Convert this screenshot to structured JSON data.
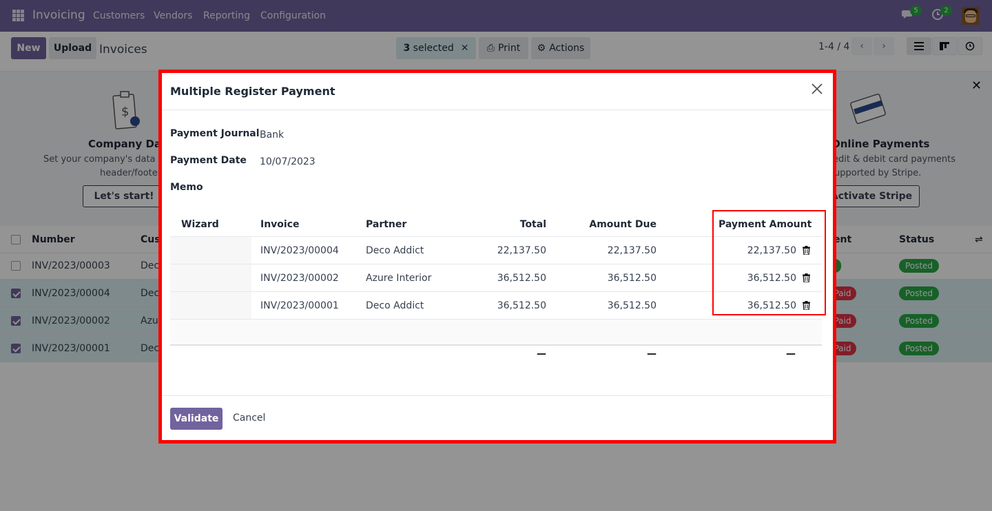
{
  "nav": {
    "app_name": "Invoicing",
    "menu": [
      "Customers",
      "Vendors",
      "Reporting",
      "Configuration"
    ],
    "chat_count": "5",
    "activity_count": "2"
  },
  "control": {
    "new_label": "New",
    "upload_label": "Upload",
    "breadcrumb": "Invoices",
    "selected_count": "3",
    "selected_label": "selected",
    "print_label": "Print",
    "actions_label": "Actions",
    "pager": "1-4 / 4"
  },
  "onboarding": {
    "left_title": "Company Data",
    "left_text1": "Set your company's data for",
    "left_text2": "header/footer.",
    "left_button": "Let's start!",
    "right_title": "Online Payments",
    "right_text1": "edit & debit card payments",
    "right_text2": "upported by Stripe.",
    "right_button": "Activate Stripe"
  },
  "list": {
    "headers": {
      "number": "Number",
      "customer": "Cust",
      "payment": "ent",
      "status": "Status"
    },
    "rows": [
      {
        "number": "INV/2023/00003",
        "customer": "Dec",
        "status": "Posted",
        "payment": "",
        "selected": false
      },
      {
        "number": "INV/2023/00004",
        "customer": "Dec",
        "status": "Posted",
        "payment": "Paid",
        "selected": true
      },
      {
        "number": "INV/2023/00002",
        "customer": "Azu",
        "status": "Posted",
        "payment": "Paid",
        "selected": true
      },
      {
        "number": "INV/2023/00001",
        "customer": "Dec",
        "status": "Posted",
        "payment": "Paid",
        "selected": true
      }
    ]
  },
  "dialog": {
    "title": "Multiple Register Payment",
    "journal_label": "Payment Journal",
    "journal_value": "Bank",
    "date_label": "Payment Date",
    "date_value": "10/07/2023",
    "memo_label": "Memo",
    "columns": {
      "wizard": "Wizard",
      "invoice": "Invoice",
      "partner": "Partner",
      "total": "Total",
      "amount_due": "Amount Due",
      "payment_amount": "Payment Amount"
    },
    "lines": [
      {
        "invoice": "INV/2023/00004",
        "partner": "Deco Addict",
        "total": "22,137.50",
        "amount_due": "22,137.50",
        "payment_amount": "22,137.50"
      },
      {
        "invoice": "INV/2023/00002",
        "partner": "Azure Interior",
        "total": "36,512.50",
        "amount_due": "36,512.50",
        "payment_amount": "36,512.50"
      },
      {
        "invoice": "INV/2023/00001",
        "partner": "Deco Addict",
        "total": "36,512.50",
        "amount_due": "36,512.50",
        "payment_amount": "36,512.50"
      }
    ],
    "totals_placeholder": "—",
    "validate_label": "Validate",
    "cancel_label": "Cancel"
  },
  "colors": {
    "brand": "#71639e",
    "highlight": "#ff0000",
    "posted": "#28a745",
    "paid": "#dc3545"
  }
}
